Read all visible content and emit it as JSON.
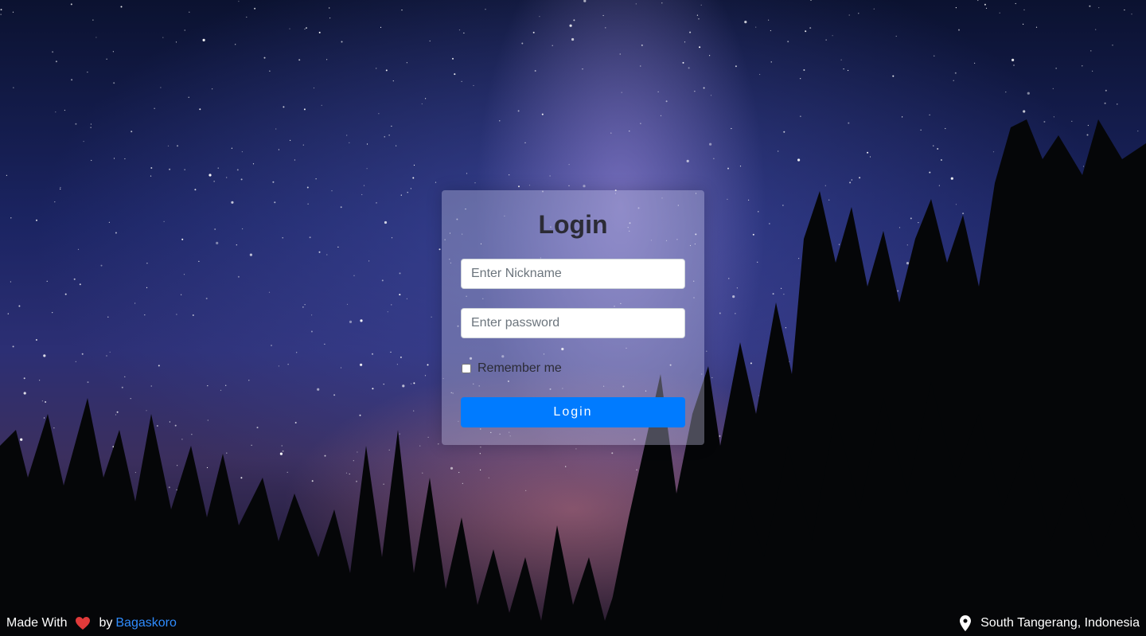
{
  "login": {
    "title": "Login",
    "nickname_placeholder": "Enter Nickname",
    "password_placeholder": "Enter password",
    "remember_label": "Remember me",
    "button_label": "Login"
  },
  "footer": {
    "made_with": "Made With",
    "by": "by",
    "author": "Bagaskoro",
    "location": "South Tangerang, Indonesia"
  },
  "icons": {
    "heart": "heart-icon",
    "location": "map-pin-icon"
  },
  "colors": {
    "primary_button": "#007bff",
    "link": "#2f8cff",
    "heart": "#e03a3a"
  }
}
